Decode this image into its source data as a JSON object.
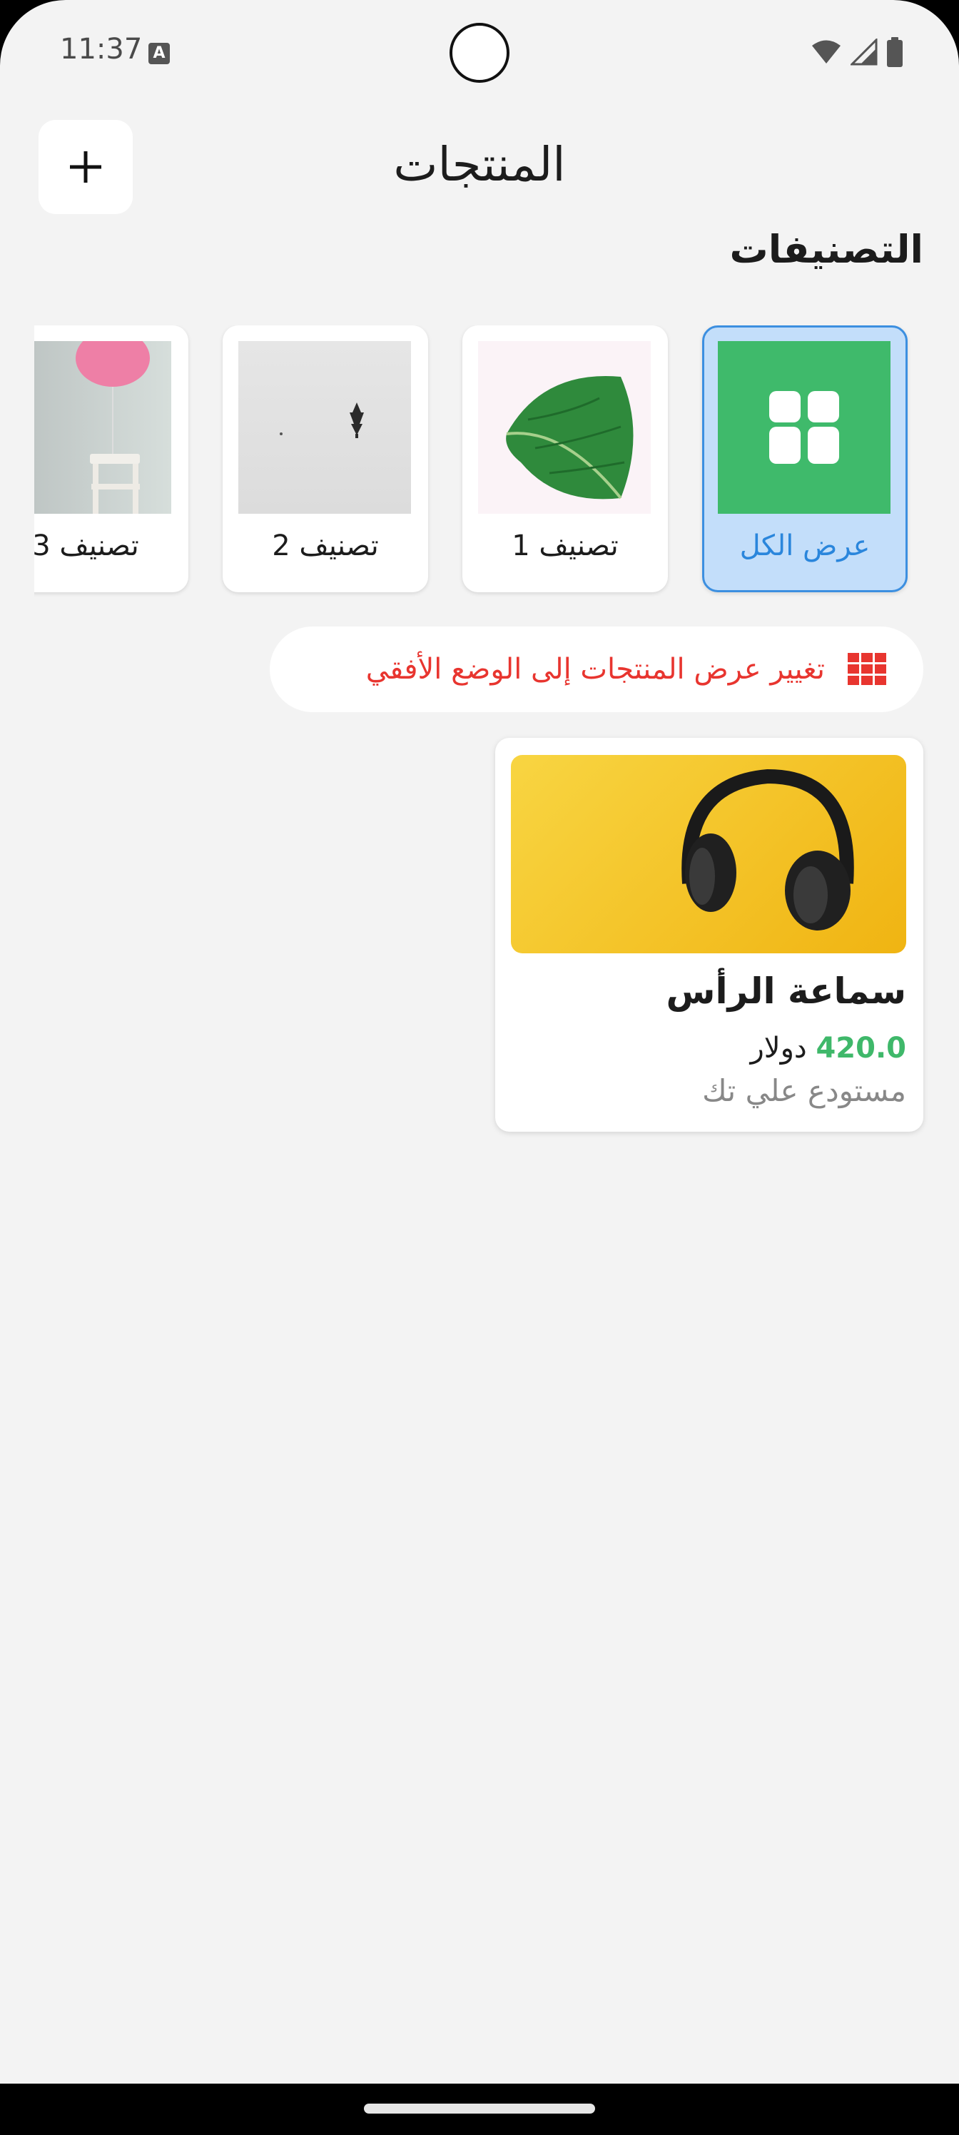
{
  "status_bar": {
    "time": "11:37",
    "notification_badge": "A",
    "icons": [
      "wifi-icon",
      "cell-signal-icon",
      "battery-icon"
    ]
  },
  "header": {
    "title": "المنتجات",
    "add_icon": "plus-icon"
  },
  "categories": {
    "section_title": "التصنيفات",
    "items": [
      {
        "label": "عرض الكل",
        "selected": true,
        "thumb": "grid-icon"
      },
      {
        "label": "تصنيف 1",
        "selected": false,
        "thumb": "leaf-photo"
      },
      {
        "label": "تصنيف 2",
        "selected": false,
        "thumb": "tree-photo"
      },
      {
        "label": "تصنيف 3",
        "selected": false,
        "thumb": "balloon-chair-photo"
      }
    ]
  },
  "layout_toggle": {
    "label": "تغيير عرض المنتجات إلى الوضع الأفقي",
    "icon": "grid-view-icon"
  },
  "products": [
    {
      "name": "سماعة الرأس",
      "price": "420.0",
      "currency": "دولار",
      "store": "مستودع علي تك",
      "image": "headphones-photo"
    }
  ],
  "colors": {
    "accent_blue": "#2a86dc",
    "selected_bg": "#c3defa",
    "price_green": "#3fb86a",
    "toggle_red": "#e8352f",
    "grid_green": "#3fba6b"
  }
}
